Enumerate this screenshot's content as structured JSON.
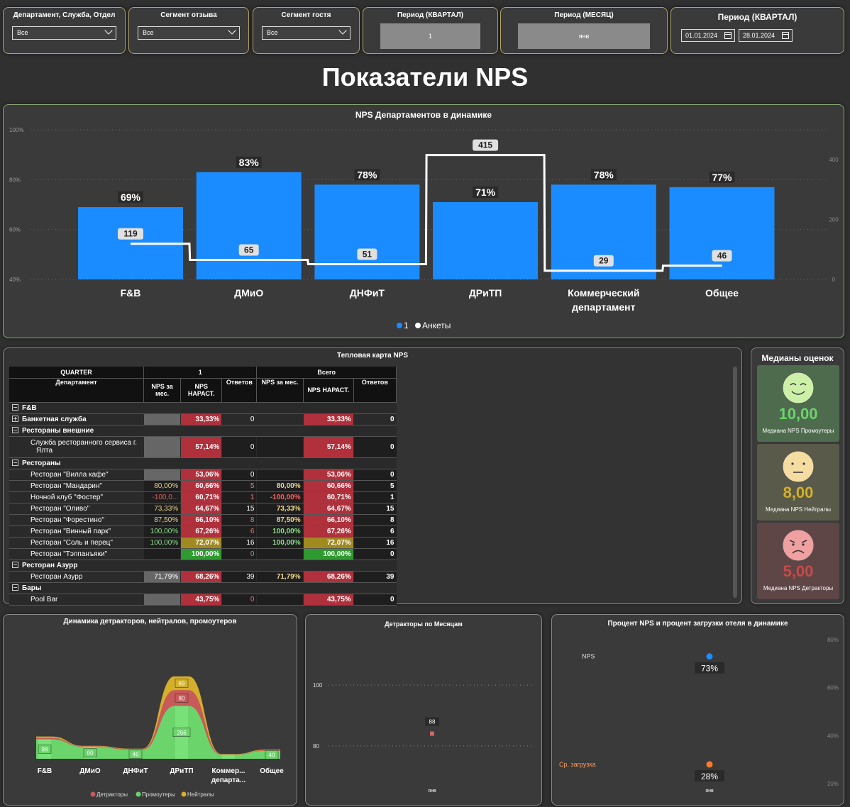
{
  "filters": {
    "department": {
      "label": "Департамент, Служба, Отдел",
      "value": "Все"
    },
    "feedback_segment": {
      "label": "Сегмент отзыва",
      "value": "Все"
    },
    "guest_segment": {
      "label": "Сегмент гостя",
      "value": "Все"
    },
    "period_quarter": {
      "label": "Период (КВАРТАЛ)",
      "value": "1"
    },
    "period_month": {
      "label": "Период (МЕСЯЦ)",
      "value": "янв"
    },
    "date_range": {
      "label": "Период (КВАРТАЛ)",
      "from": "01.01.2024",
      "to": "28.01.2024"
    }
  },
  "page_title": "Показатели NPS",
  "dept_chart": {
    "title": "NPS Департаментов в динамике",
    "legend": [
      "1",
      "Анкеты"
    ],
    "colors": {
      "bar": "#1a8cff",
      "line": "#ffffff"
    }
  },
  "chart_data": [
    {
      "type": "bar",
      "title": "NPS Департаментов в динамике",
      "categories": [
        "F&B",
        "ДМиО",
        "ДНФиТ",
        "ДРиТП",
        "Коммерческий департамент",
        "Общее"
      ],
      "category_lines": [
        [
          "F&B"
        ],
        [
          "ДМиО"
        ],
        [
          "ДНФиТ"
        ],
        [
          "ДРиТП"
        ],
        [
          "Коммерческий",
          "департамент"
        ],
        [
          "Общее"
        ]
      ],
      "series": [
        {
          "name": "1",
          "values": [
            69,
            83,
            78,
            71,
            78,
            77
          ],
          "labels": [
            "69%",
            "83%",
            "78%",
            "71%",
            "78%",
            "77%"
          ],
          "axis": "left"
        },
        {
          "name": "Анкеты",
          "values": [
            119,
            65,
            51,
            415,
            29,
            46
          ],
          "axis": "right"
        }
      ],
      "y_left": {
        "ticks": [
          "100%",
          "80%",
          "60%",
          "40%"
        ],
        "values": [
          100,
          80,
          60,
          40
        ],
        "ylim": [
          40,
          100
        ]
      },
      "y_right": {
        "ticks": [
          "400",
          "200",
          "0"
        ],
        "values": [
          400,
          200,
          0
        ],
        "ylim": [
          0,
          400
        ]
      },
      "legend_position": "bottom-center"
    },
    {
      "type": "area",
      "title": "Динамика детракторов, нейтралов, промоутеров",
      "categories": [
        "F&B",
        "ДМиО",
        "ДНФиТ",
        "ДРиТП",
        "Коммер... департа...",
        "Общее"
      ],
      "category_lines": [
        [
          "F&B"
        ],
        [
          "ДМиО"
        ],
        [
          "ДНФиТ"
        ],
        [
          "ДРиТП"
        ],
        [
          "Коммер...",
          "департа..."
        ],
        [
          "Общее"
        ]
      ],
      "series": [
        {
          "name": "Промоутеры",
          "values": [
            98,
            60,
            46,
            266,
            20,
            40
          ],
          "color": "#6bd46b"
        },
        {
          "name": "Детракторы",
          "values": [
            8,
            3,
            3,
            80,
            2,
            3
          ],
          "color": "#c85a5a"
        },
        {
          "name": "Нейтралы",
          "values": [
            6,
            2,
            2,
            69,
            2,
            3
          ],
          "color": "#d4b02a"
        }
      ],
      "point_labels": [
        {
          "category": "F&B",
          "series": "Промоутеры",
          "text": "98"
        },
        {
          "category": "ДМиО",
          "series": "Промоутеры",
          "text": "60"
        },
        {
          "category": "ДНФиТ",
          "series": "Промоутеры",
          "text": "46"
        },
        {
          "category": "ДРиТП",
          "series": "Промоутеры",
          "text": "266"
        },
        {
          "category": "ДРиТП",
          "series": "Детракторы",
          "text": "80"
        },
        {
          "category": "ДРиТП",
          "series": "Нейтралы",
          "text": "69"
        },
        {
          "category": "Общее",
          "series": "Промоутеры",
          "text": "40"
        }
      ],
      "legend_position": "bottom-center"
    },
    {
      "type": "scatter",
      "title": "Детракторы по Месяцам",
      "x": [
        "янв"
      ],
      "series": [
        {
          "values": [
            88
          ],
          "color": "#d9626b"
        }
      ],
      "y_ticks": [
        "100",
        "80"
      ],
      "y_tick_values": [
        100,
        80
      ],
      "ylim": [
        76,
        104
      ]
    },
    {
      "type": "scatter",
      "title": "Процент NPS и процент загрузки отеля в динамике",
      "x": [
        "янв"
      ],
      "series": [
        {
          "name": "NPS",
          "values": [
            73
          ],
          "label": "73%",
          "color": "#1a8cff"
        },
        {
          "name": "Ср. загрузка",
          "values": [
            28
          ],
          "label": "28%",
          "color": "#ff7a2a"
        }
      ],
      "y_ticks": [
        "80%",
        "60%",
        "40%",
        "20%"
      ],
      "y_tick_values": [
        80,
        60,
        40,
        20
      ],
      "ylim": [
        20,
        80
      ]
    }
  ],
  "heatmap": {
    "title": "Тепловая карта NPS",
    "header_row1": [
      "QUARTER",
      "1",
      "Всего"
    ],
    "header_row2": [
      "Департамент",
      "NPS за мес.",
      "NPS НАРАСТ.",
      "Ответов",
      "NPS за мес.",
      "NPS НАРАСТ.",
      "Ответов"
    ],
    "rows": [
      {
        "level": 0,
        "toggle": "minus",
        "label": "F&B",
        "cells": [
          "",
          "",
          "",
          "",
          "",
          ""
        ],
        "colors": [
          "",
          "",
          "",
          "",
          "",
          ""
        ]
      },
      {
        "level": 1,
        "toggle": "plus",
        "label": "Банкетная служба",
        "cells": [
          "",
          "33,33%",
          "0",
          "",
          "33,33%",
          "0"
        ],
        "colors": [
          "#666",
          "#b0303c",
          "",
          "",
          "#b0303c",
          ""
        ]
      },
      {
        "level": 1,
        "toggle": "minus",
        "label": "Рестораны внешние",
        "cells": [
          "",
          "",
          "",
          "",
          "",
          ""
        ],
        "colors": [
          "",
          "",
          "",
          "",
          "",
          ""
        ]
      },
      {
        "level": 2,
        "label": "Служба ресторанного сервиса г. Ялта",
        "cells": [
          "",
          "57,14%",
          "0",
          "",
          "57,14%",
          "0"
        ],
        "colors": [
          "#666",
          "#b0303c",
          "",
          "",
          "#b0303c",
          ""
        ],
        "tall": true
      },
      {
        "level": 1,
        "toggle": "minus",
        "label": "Рестораны",
        "cells": [
          "",
          "",
          "",
          "",
          "",
          ""
        ],
        "colors": [
          "",
          "",
          "",
          "",
          "",
          ""
        ]
      },
      {
        "level": 2,
        "label": "Ресторан \"Вилла кафе\"",
        "cells": [
          "",
          "53,06%",
          "0",
          "",
          "53,06%",
          "0"
        ],
        "colors": [
          "#666",
          "#b0303c",
          "",
          "",
          "#b0303c",
          ""
        ]
      },
      {
        "level": 2,
        "label": "Ресторан \"Мандарин\"",
        "cells": [
          "80,00%",
          "60,66%",
          "5",
          "80,00%",
          "60,66%",
          "5"
        ],
        "colors": [
          "",
          "#b0303c",
          "",
          "",
          "#b0303c",
          ""
        ],
        "fg": [
          "#e8d08a",
          "",
          "#e87a7a",
          "#f0d88a",
          "",
          ""
        ]
      },
      {
        "level": 2,
        "label": "Ночной клуб \"Фостер\"",
        "cells": [
          "-100,0...",
          "60,71%",
          "1",
          "-100,00%",
          "60,71%",
          "1"
        ],
        "colors": [
          "",
          "#b0303c",
          "",
          "",
          "#b0303c",
          ""
        ],
        "fg": [
          "#e06060",
          "",
          "#e87a7a",
          "#ff6060",
          "",
          ""
        ]
      },
      {
        "level": 2,
        "label": "Ресторан \"Оливо\"",
        "cells": [
          "73,33%",
          "64,67%",
          "15",
          "73,33%",
          "64,67%",
          "15"
        ],
        "colors": [
          "",
          "#b0303c",
          "",
          "",
          "#b0303c",
          ""
        ],
        "fg": [
          "#e8d08a",
          "",
          "",
          "#f0d88a",
          "",
          ""
        ]
      },
      {
        "level": 2,
        "label": "Ресторан \"Форестино\"",
        "cells": [
          "87,50%",
          "66,10%",
          "8",
          "87,50%",
          "66,10%",
          "8"
        ],
        "colors": [
          "",
          "#b0303c",
          "",
          "",
          "#b0303c",
          ""
        ],
        "fg": [
          "#e8d08a",
          "",
          "#e87a7a",
          "#f0d88a",
          "",
          ""
        ]
      },
      {
        "level": 2,
        "label": "Ресторан \"Винный парк\"",
        "cells": [
          "100,00%",
          "67,26%",
          "6",
          "100,00%",
          "67,26%",
          "6"
        ],
        "colors": [
          "",
          "#b0303c",
          "",
          "",
          "#b0303c",
          ""
        ],
        "fg": [
          "#8ae08a",
          "",
          "#e87a7a",
          "#8ae08a",
          "",
          ""
        ]
      },
      {
        "level": 2,
        "label": "Ресторан \"Соль и перец\"",
        "cells": [
          "100,00%",
          "72,07%",
          "16",
          "100,00%",
          "72,07%",
          "16"
        ],
        "colors": [
          "",
          "#a08a20",
          "",
          "",
          "#a08a20",
          ""
        ],
        "fg": [
          "#8ae08a",
          "",
          "",
          "#8ae08a",
          "",
          ""
        ]
      },
      {
        "level": 2,
        "label": "Ресторан \"Тэппанъяки\"",
        "cells": [
          "",
          "100,00%",
          "0",
          "",
          "100,00%",
          "0"
        ],
        "colors": [
          "",
          "#2f9a2f",
          "",
          "",
          "#2f9a2f",
          ""
        ],
        "fg": [
          "",
          "",
          "#e87a7a",
          "",
          "",
          ""
        ]
      },
      {
        "level": 1,
        "toggle": "minus",
        "label": "Ресторан Азурр",
        "cells": [
          "",
          "",
          "",
          "",
          "",
          ""
        ],
        "colors": [
          "",
          "",
          "",
          "",
          "",
          ""
        ]
      },
      {
        "level": 2,
        "label": "Ресторан Азурр",
        "cells": [
          "71,79%",
          "68,26%",
          "39",
          "71,79%",
          "68,26%",
          "39"
        ],
        "colors": [
          "#666",
          "#b0303c",
          "",
          "",
          "#b0303c",
          ""
        ],
        "fg": [
          "",
          "",
          "",
          "#f0d88a",
          "",
          ""
        ]
      },
      {
        "level": 1,
        "toggle": "minus",
        "label": "Бары",
        "cells": [
          "",
          "",
          "",
          "",
          "",
          ""
        ],
        "colors": [
          "",
          "",
          "",
          "",
          "",
          ""
        ]
      },
      {
        "level": 2,
        "label": "Pool Bar",
        "cells": [
          "",
          "43,75%",
          "0",
          "",
          "43,75%",
          "0"
        ],
        "colors": [
          "#666",
          "#b0303c",
          "",
          "",
          "#b0303c",
          ""
        ],
        "fg": [
          "",
          "",
          "#e87a7a",
          "",
          "",
          ""
        ]
      }
    ]
  },
  "medians": {
    "title": "Медианы оценок",
    "items": [
      {
        "value": "10,00",
        "caption": "Медиана NPS Промоутеры",
        "color": "#6bd46b",
        "face": "happy-face-icon"
      },
      {
        "value": "8,00",
        "caption": "Медиана NPS Нейтралы",
        "color": "#d4b02a",
        "face": "neutral-face-icon"
      },
      {
        "value": "5,00",
        "caption": "Медиана NPS Детракторы",
        "color": "#c84a4a",
        "face": "angry-face-icon"
      }
    ]
  }
}
